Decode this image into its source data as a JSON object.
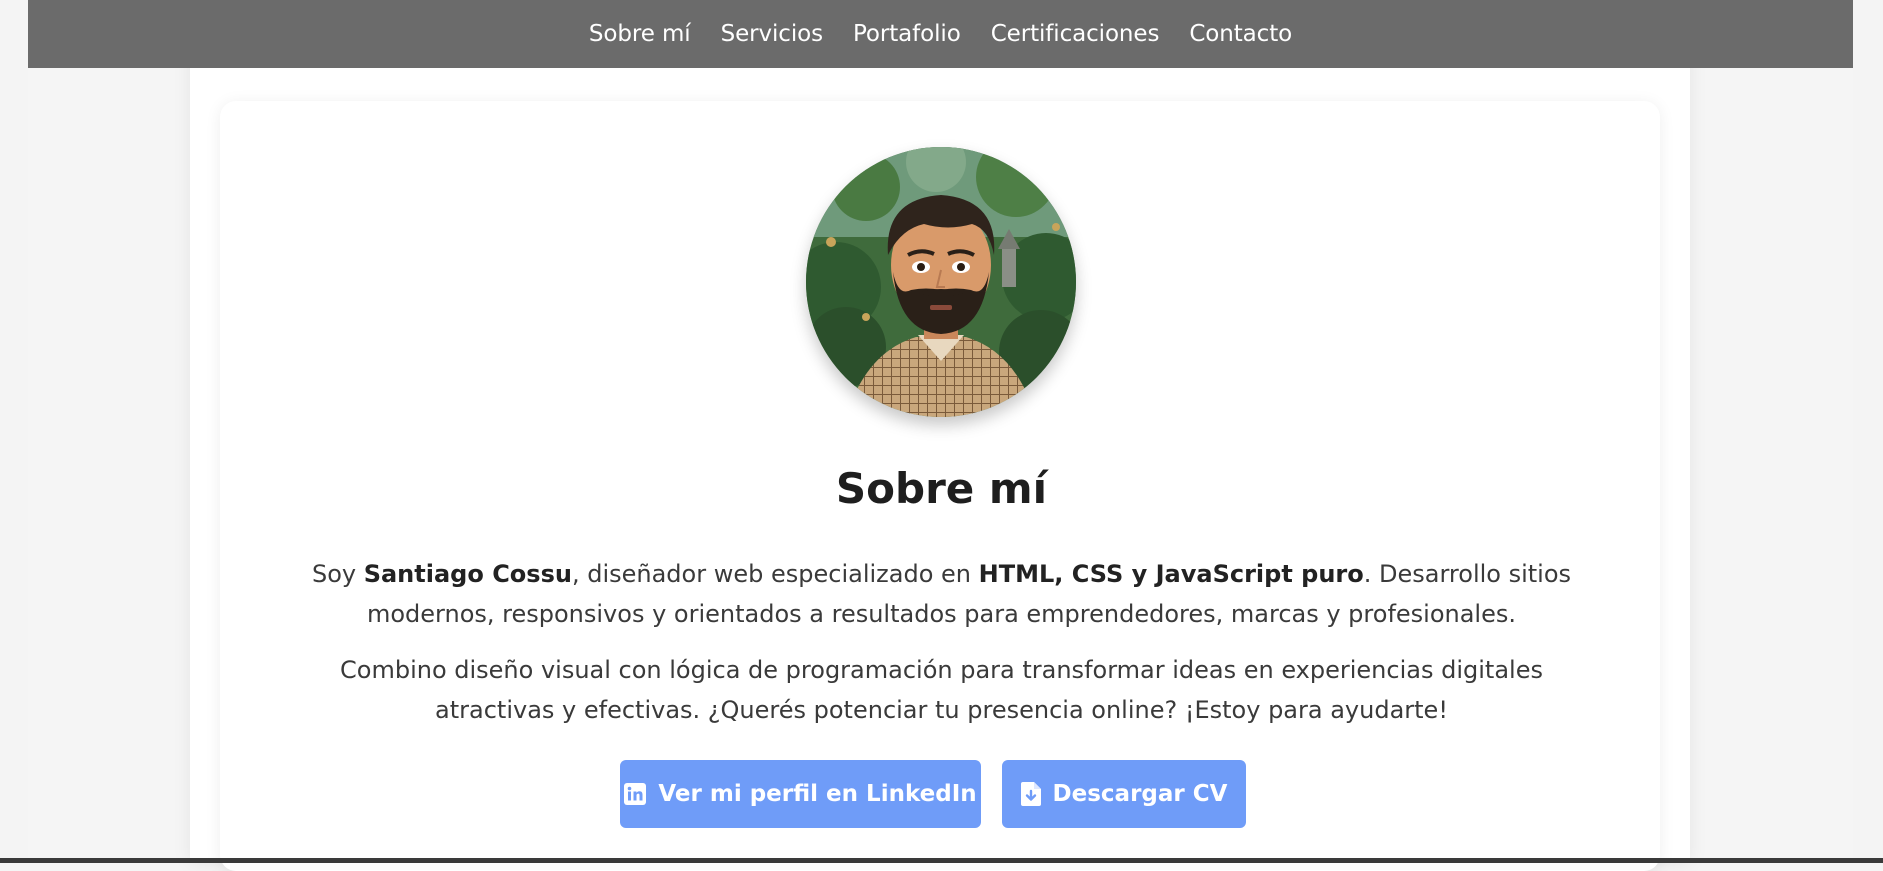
{
  "nav": {
    "items": [
      "Sobre mí",
      "Servicios",
      "Portafolio",
      "Certificaciones",
      "Contacto"
    ]
  },
  "about": {
    "title": "Sobre mí",
    "p1": {
      "t1": "Soy ",
      "name": "Santiago Cossu",
      "t2": ", diseñador web especializado en ",
      "skills": "HTML, CSS y JavaScript puro",
      "t3": ". Desarrollo sitios modernos, responsivos y orientados a resultados para emprendedores, marcas y profesionales."
    },
    "p2": "Combino diseño visual con lógica de programación para transformar ideas en experiencias digitales atractivas y efectivas. ¿Querés potenciar tu presencia online? ¡Estoy para ayudarte!"
  },
  "buttons": {
    "linkedin": "Ver mi perfil en LinkedIn",
    "cv": "Descargar CV"
  },
  "icons": {
    "linkedin": "linkedin-icon",
    "cv": "file-download-icon"
  },
  "colors": {
    "navbar": "#6b6b6b",
    "button": "#6f9cf8",
    "title": "#1e1e1e",
    "text": "#3a3a3a"
  }
}
